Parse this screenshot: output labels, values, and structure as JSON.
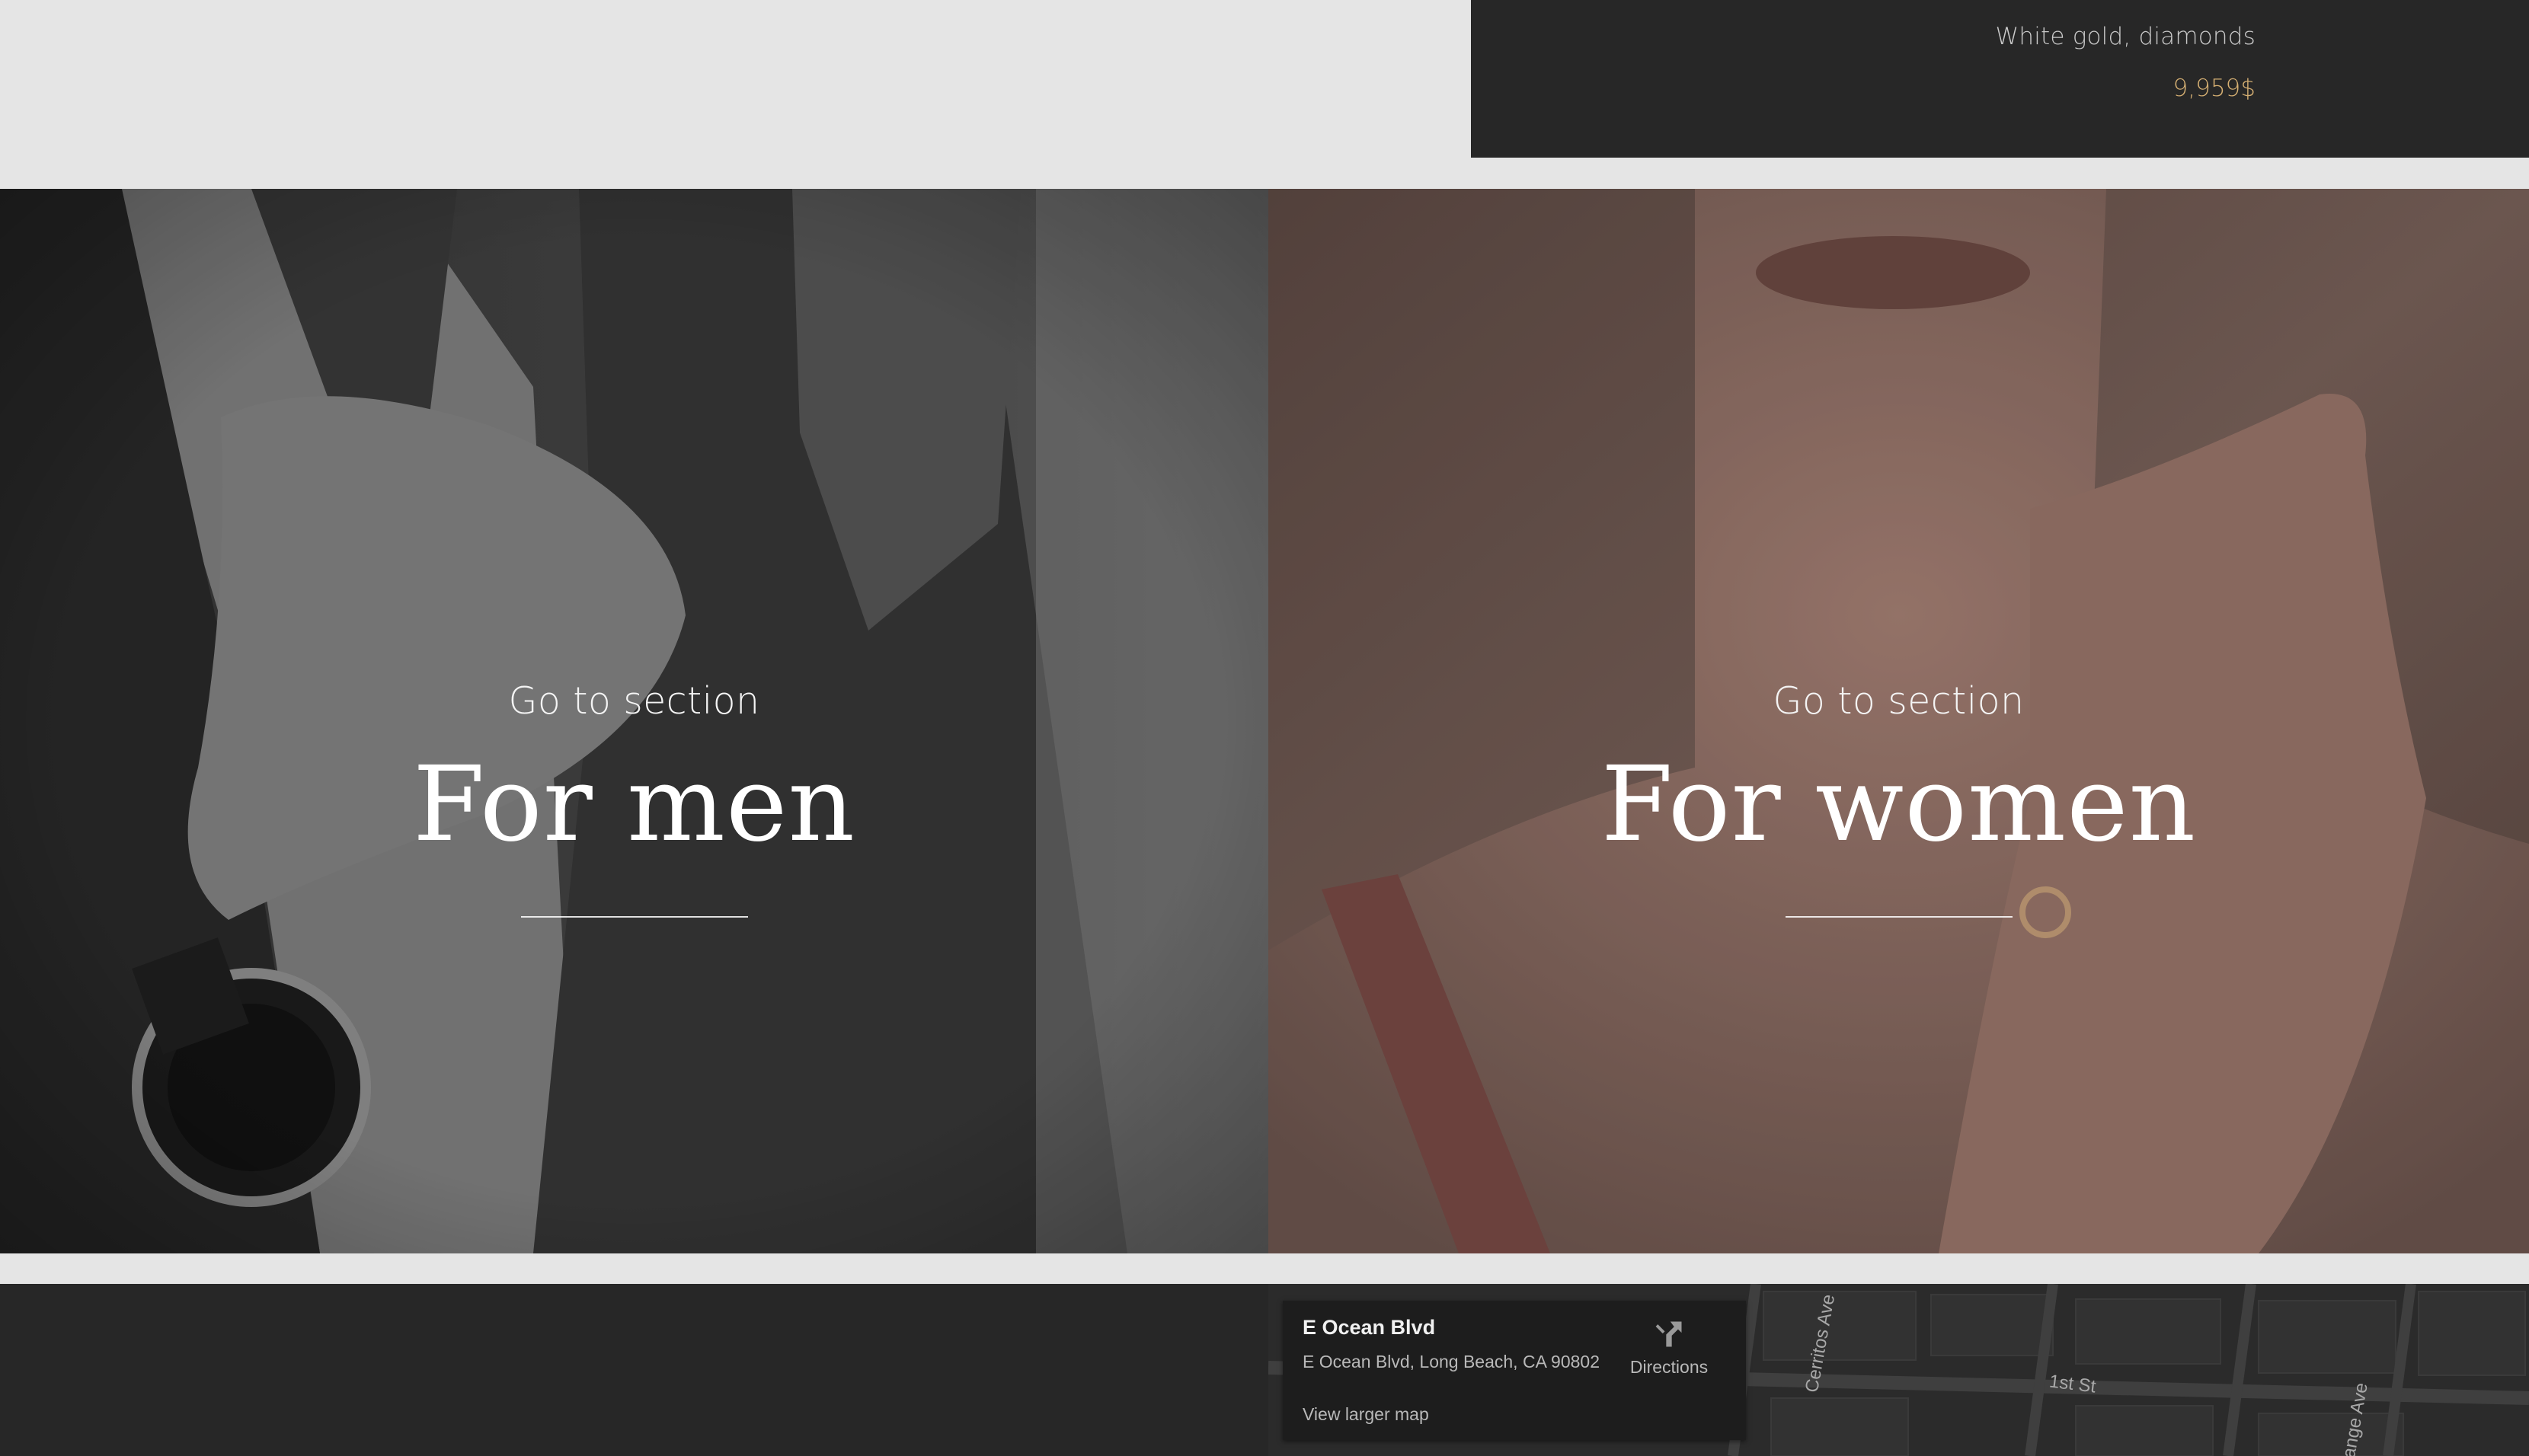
{
  "product_card": {
    "material": "White gold, diamonds",
    "price": "9,959$"
  },
  "sections": [
    {
      "goto_label": "Go to section",
      "title": "For men"
    },
    {
      "goto_label": "Go to section",
      "title": "For women"
    }
  ],
  "map": {
    "place_name": "E Ocean Blvd",
    "address": "E Ocean Blvd, Long Beach, CA 90802",
    "directions_label": "Directions",
    "larger_map_label": "View larger map",
    "street_labels": [
      "1st St",
      "Cerritos Ave",
      "ange Ave"
    ]
  },
  "colors": {
    "card_background": "#272727",
    "price_accent": "#d6b073",
    "page_background": "#e5e5e5"
  }
}
